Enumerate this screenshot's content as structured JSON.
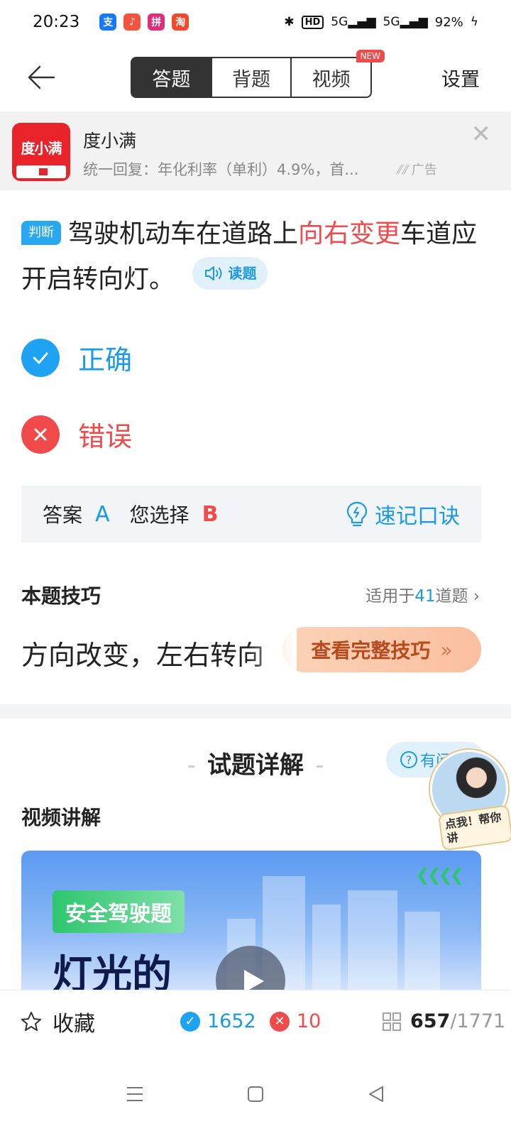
{
  "status_bar": {
    "time": "20:23",
    "apps": [
      {
        "icon": "alipay-icon",
        "glyph": "支",
        "color": "#1677ff"
      },
      {
        "icon": "music-icon",
        "glyph": "♪",
        "color": "#f5533d"
      },
      {
        "icon": "pinduoduo-icon",
        "glyph": "拼",
        "color": "#e02e7a"
      },
      {
        "icon": "taobao-icon",
        "glyph": "淘",
        "color": "#f04a2a"
      }
    ],
    "network_1": "5G",
    "network_2": "5G",
    "hd": "HD",
    "battery": "92%"
  },
  "header": {
    "tabs": [
      {
        "label": "答题",
        "active": true
      },
      {
        "label": "背题",
        "active": false
      },
      {
        "label": "视频",
        "active": false,
        "badge": "NEW"
      }
    ],
    "settings_label": "设置"
  },
  "ad": {
    "logo_text": "度小满",
    "title": "度小满",
    "description": "统一回复：年化利率（单利）4.9%，首...",
    "tag": "广告"
  },
  "question": {
    "type": "判断",
    "text_before": "驾驶机动车在道路上",
    "highlight": "向右变更",
    "text_after": "车道应开启转向灯。",
    "read_label": "读题"
  },
  "options": [
    {
      "label": "正确",
      "status": "correct"
    },
    {
      "label": "错误",
      "status": "wrong"
    }
  ],
  "answer": {
    "answer_label": "答案",
    "answer_value": "A",
    "chosen_label": "您选择",
    "chosen_value": "B",
    "mnemonic_label": "速记口诀"
  },
  "tips": {
    "title": "本题技巧",
    "apply_prefix": "适用于",
    "apply_count": "41",
    "apply_suffix": "道题",
    "text": "方向改变，左右转向",
    "button_label": "查看完整技巧"
  },
  "explanation": {
    "title": "试题详解",
    "ask_label": "有问题",
    "video_label": "视频讲解",
    "avatar_caption": "点我！帮你讲",
    "video_badge": "安全驾驶题",
    "video_title": "灯光的"
  },
  "bottom": {
    "favorite_label": "收藏",
    "correct_count": "1652",
    "wrong_count": "10",
    "current": "657",
    "total": "/1771"
  },
  "colors": {
    "blue": "#1a9ae6",
    "red": "#f04a4a",
    "dark": "#333333"
  }
}
